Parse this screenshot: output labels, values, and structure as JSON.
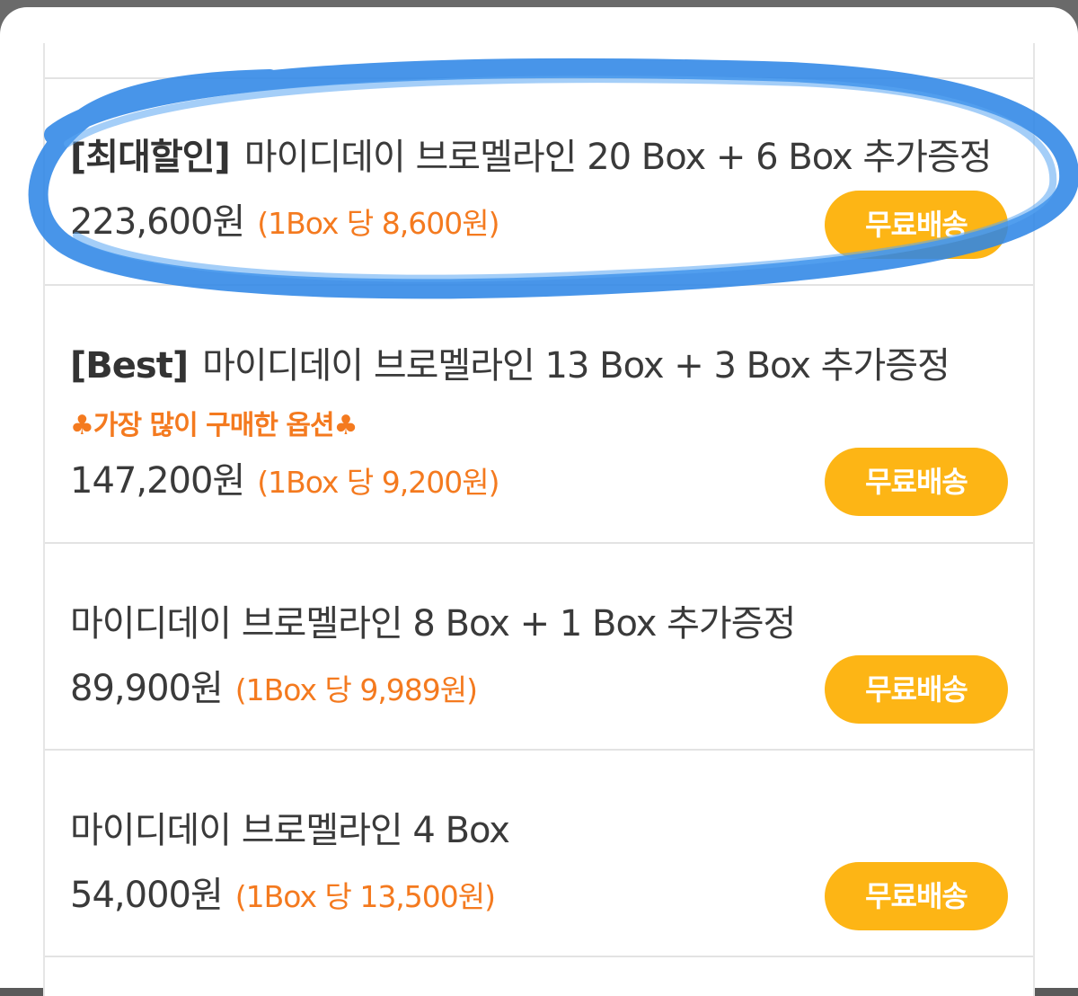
{
  "sheet": {
    "options": [
      {
        "tag": "[최대할인]",
        "name": "마이디데이 브로멜라인 20 Box + 6 Box 추가증정",
        "promo": "",
        "price": "223,600원",
        "unit_price": "(1Box 당 8,600원)",
        "shipping": "무료배송"
      },
      {
        "tag": "[Best]",
        "name": "마이디데이 브로멜라인 13 Box + 3 Box 추가증정",
        "promo": "♣가장 많이 구매한 옵션♣",
        "price": "147,200원",
        "unit_price": "(1Box 당 9,200원)",
        "shipping": "무료배송"
      },
      {
        "tag": "",
        "name": "마이디데이 브로멜라인 8 Box + 1 Box 추가증정",
        "promo": "",
        "price": "89,900원",
        "unit_price": "(1Box 당 9,989원)",
        "shipping": "무료배송"
      },
      {
        "tag": "",
        "name": "마이디데이 브로멜라인 4 Box",
        "promo": "",
        "price": "54,000원",
        "unit_price": "(1Box 당 13,500원)",
        "shipping": "무료배송"
      }
    ]
  },
  "colors": {
    "accent_orange": "#f47a1f",
    "shipping_badge": "#fdb515",
    "annotation_marker": "#2f86e6"
  }
}
